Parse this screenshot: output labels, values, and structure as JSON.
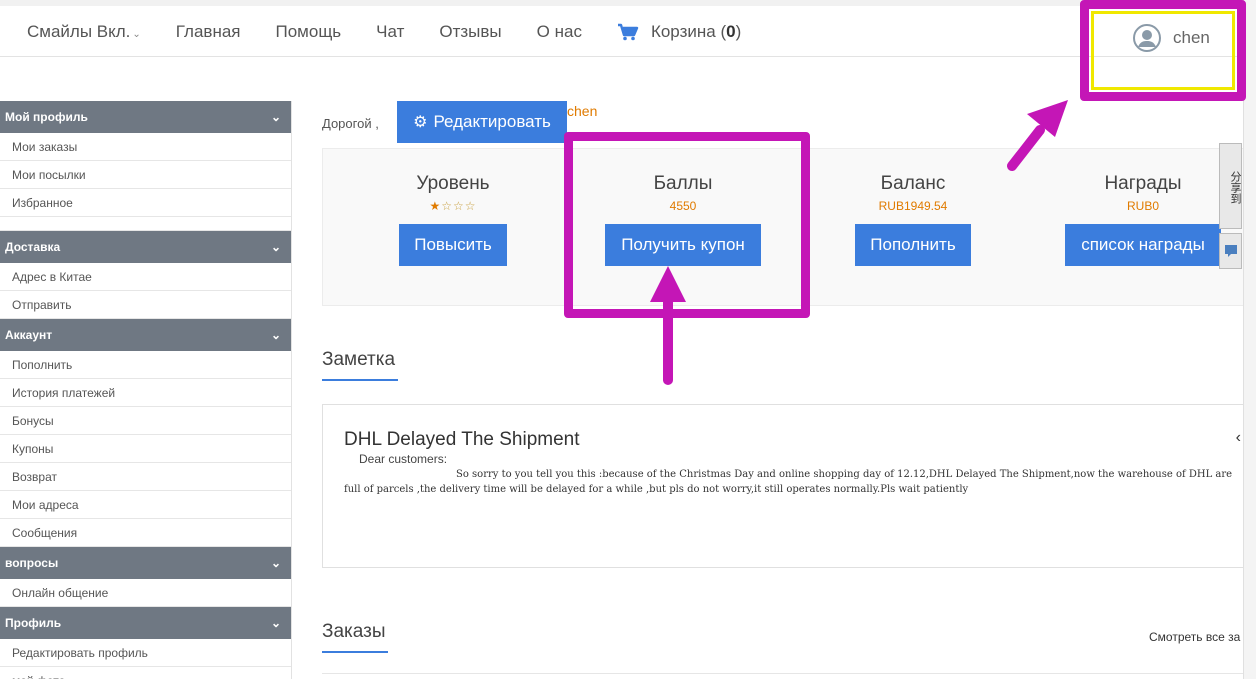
{
  "nav": {
    "smiles": "Смайлы Вкл.",
    "home": "Главная",
    "help": "Помощь",
    "chat": "Чат",
    "reviews": "Отзывы",
    "about": "О нас",
    "cart_label": "Корзина",
    "cart_count": "0",
    "username": "chen"
  },
  "sidebar": {
    "sections": [
      {
        "title": "Мой профиль",
        "items": [
          "Мои заказы",
          "Мои посылки",
          "Избранное"
        ]
      },
      {
        "title": "Доставка",
        "items": [
          "Адрес в Китае",
          "Отправить"
        ]
      },
      {
        "title": "Аккаунт",
        "items": [
          "Пополнить",
          "История платежей",
          "Бонусы",
          "Купоны",
          "Возврат",
          "Мои адреса",
          "Сообщения"
        ]
      },
      {
        "title": "вопросы",
        "items": [
          "Онлайн общение"
        ]
      },
      {
        "title": "Профиль",
        "items": [
          "Редактировать профиль",
          "мой фото"
        ]
      }
    ]
  },
  "greeting": {
    "prefix": "Дорогой ,",
    "edit_button": "Редактировать",
    "username": "chen"
  },
  "stats": {
    "level": {
      "title": "Уровень",
      "stars_filled": 1,
      "stars_total": 4,
      "button": "Повысить"
    },
    "points": {
      "title": "Баллы",
      "value": "4550",
      "button": "Получить купон"
    },
    "balance": {
      "title": "Баланс",
      "value": "RUB1949.54",
      "button": "Пополнить"
    },
    "rewards": {
      "title": "Награды",
      "value": "RUB0",
      "button": "список награды"
    }
  },
  "note": {
    "section_title": "Заметка",
    "title": "DHL Delayed The Shipment",
    "greeting": "Dear customers:",
    "body": "So sorry to you tell you this :because of the   Christmas Day and online shopping day of   12.12,DHL Delayed The Shipment,now the warehouse of DHL are full of parcels ,the delivery time will be delayed for a while ,but pls do not worry,it still operates normally.Pls wait patiently"
  },
  "orders": {
    "section_title": "Заказы",
    "view_all": "Смотреть все за"
  },
  "share_widget": "分享到",
  "colors": {
    "accent": "#3b7ddd",
    "highlight_value": "#e07b00",
    "sidebar_header": "#6f7883",
    "annotation": "#c416b6",
    "annotation_inner": "#f0e800"
  },
  "icons": {
    "cart": "cart-icon",
    "user": "user-avatar-icon",
    "gear": "gear-icon",
    "chevron": "chevron-down-icon"
  }
}
